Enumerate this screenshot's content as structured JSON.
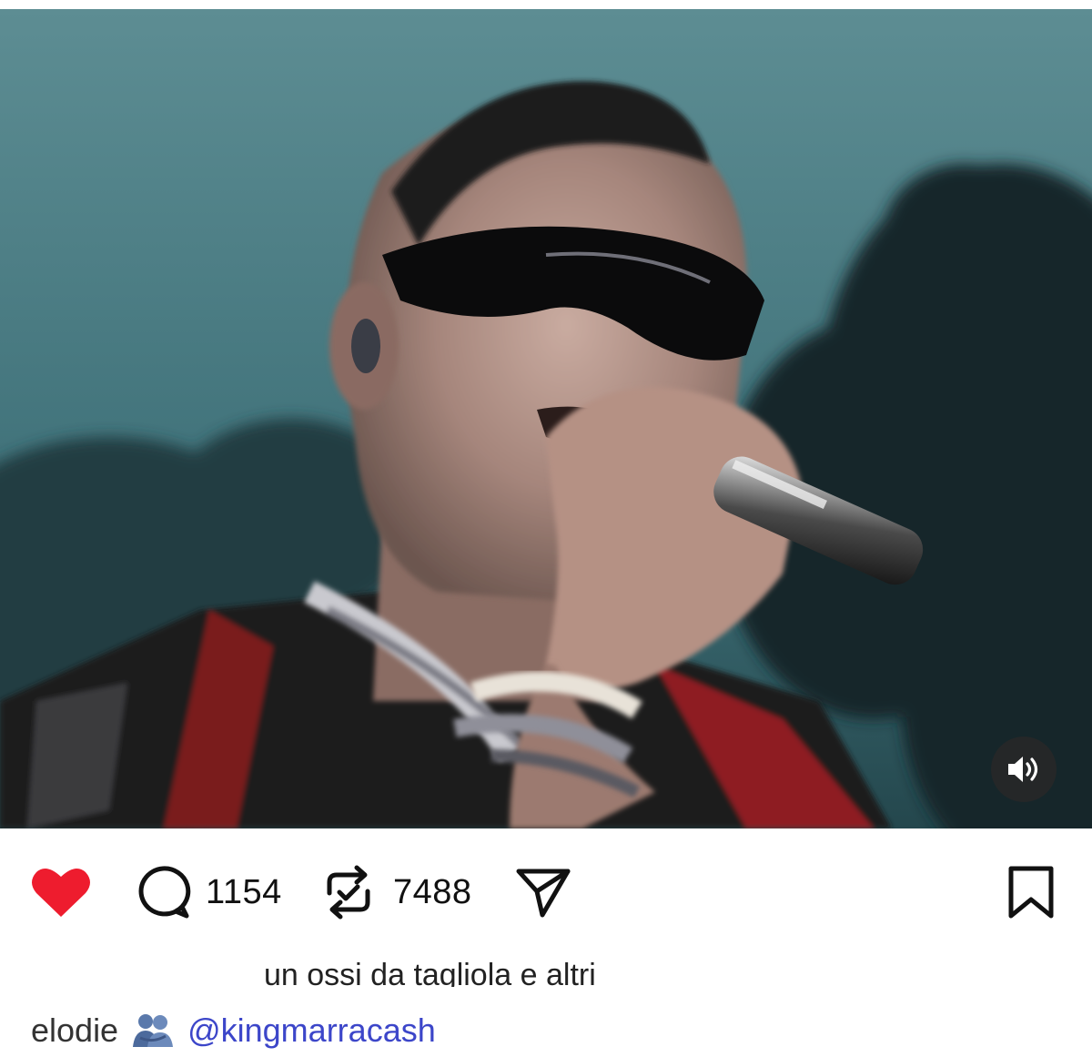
{
  "media": {
    "kind": "video",
    "volume_icon": "speaker-volume-icon"
  },
  "actions": {
    "like_icon": "heart-filled-icon",
    "comment_icon": "comment-bubble-icon",
    "comment_count": "1154",
    "repost_icon": "repost-arrows-icon",
    "repost_count": "7488",
    "share_icon": "paper-plane-icon",
    "bookmark_icon": "bookmark-icon",
    "like_color": "#ee1c2e"
  },
  "caption": {
    "partial_line": "un ossi da tagliola e altri",
    "username": "elodie",
    "emoji_icon": "people-hugging-icon",
    "mention": "@kingmarracash",
    "mention_color": "#3c46c9"
  }
}
